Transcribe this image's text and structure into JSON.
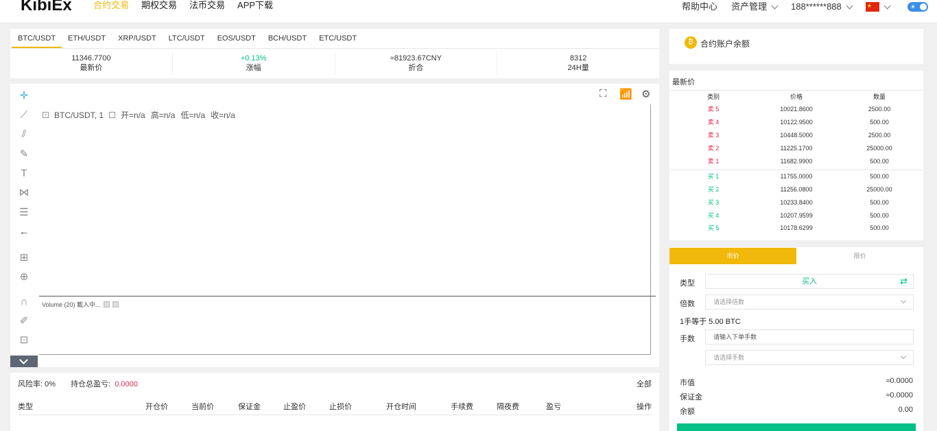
{
  "brand": "KibiEx",
  "nav": {
    "links": [
      "合约交易",
      "期权交易",
      "法币交易",
      "APP下载"
    ],
    "help": "帮助中心",
    "assets": "资产管理",
    "account": "188******888"
  },
  "pairs": [
    "BTC/USDT",
    "ETH/USDT",
    "XRP/USDT",
    "LTC/USDT",
    "EOS/USDT",
    "BCH/USDT",
    "ETC/USDT"
  ],
  "stats": [
    {
      "value": "11346.7700",
      "label": "最新价"
    },
    {
      "value": "+0.13%",
      "label": "涨幅"
    },
    {
      "value": "≈81923.67CNY",
      "label": "折合"
    },
    {
      "value": "8312",
      "label": "24H量"
    }
  ],
  "chart": {
    "symbol": "BTC/USDT, 1",
    "open": "开=n/a",
    "high": "高=n/a",
    "low": "低=n/a",
    "close": "收=n/a",
    "volume": "Volume (20) 載入中..."
  },
  "positions": {
    "risk_label": "风险率:",
    "risk_value": "0%",
    "pnl_label": "持仓总盈亏:",
    "pnl_value": "0.0000",
    "all": "全部",
    "headers": [
      "类型",
      "开仓价",
      "当前价",
      "保证金",
      "止盈价",
      "止损价",
      "开仓时间",
      "手续费",
      "隔夜费",
      "盈亏",
      "操作"
    ]
  },
  "balance": {
    "label": "合约账户余额"
  },
  "orderbook": {
    "title": "最新价",
    "headers": [
      "类别",
      "价格",
      "数量"
    ],
    "asks": [
      {
        "side": "卖 5",
        "price": "10021.8600",
        "qty": "2500.00"
      },
      {
        "side": "卖 4",
        "price": "10122.9500",
        "qty": "500.00"
      },
      {
        "side": "卖 3",
        "price": "10448.5000",
        "qty": "2500.00"
      },
      {
        "side": "卖 2",
        "price": "11225.1700",
        "qty": "25000.00"
      },
      {
        "side": "卖 1",
        "price": "11682.9900",
        "qty": "500.00"
      }
    ],
    "bids": [
      {
        "side": "买 1",
        "price": "11755.0000",
        "qty": "500.00"
      },
      {
        "side": "买 2",
        "price": "11256.0800",
        "qty": "25000.00"
      },
      {
        "side": "买 3",
        "price": "10233.8400",
        "qty": "500.00"
      },
      {
        "side": "买 4",
        "price": "10207.9599",
        "qty": "500.00"
      },
      {
        "side": "买 5",
        "price": "10178.6299",
        "qty": "500.00"
      }
    ]
  },
  "trade": {
    "tabs": [
      "市价",
      "限价"
    ],
    "type_label": "类型",
    "type_value": "买入",
    "multiple_label": "倍数",
    "multiple_placeholder": "请选择倍数",
    "lot_info": "1手等于 5.00 BTC",
    "lots_label": "手数",
    "lots_placeholder": "请输入下单手数",
    "lots_select_placeholder": "请选择手数",
    "market_value_label": "市值",
    "market_value": "≈0.0000",
    "margin_label": "保证金",
    "margin_value": "≈0.0000",
    "balance_label": "余额",
    "balance_value": "0.00"
  },
  "colors": {
    "accent": "#f0b90b",
    "buy": "#03c087",
    "sell": "#e0294a"
  }
}
